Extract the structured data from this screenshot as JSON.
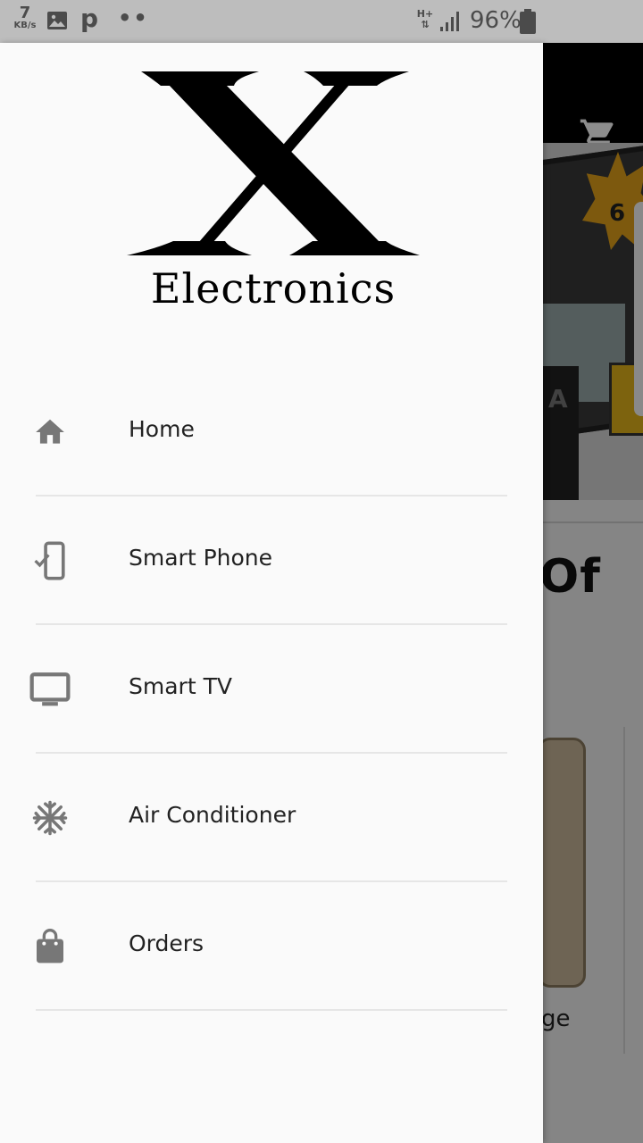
{
  "status_bar": {
    "speed_value": "7",
    "speed_unit": "KB/s",
    "app_letter": "p",
    "dots": "••",
    "network_type_top": "H+",
    "network_type_bottom": "⇅",
    "battery_percent": "96%"
  },
  "background": {
    "headline_fragment": "Of",
    "caption_fragment": "ge",
    "banner_badge": "6",
    "banner_letter": "A",
    "cart_icon": "shopping-cart-icon"
  },
  "drawer": {
    "logo": {
      "letter": "X",
      "wordmark": "Electronics"
    },
    "menu": [
      {
        "label": "Home",
        "icon": "home-icon"
      },
      {
        "label": "Smart Phone",
        "icon": "smartphone-check-icon"
      },
      {
        "label": "Smart TV",
        "icon": "tv-icon"
      },
      {
        "label": "Air Conditioner",
        "icon": "snowflake-icon"
      },
      {
        "label": "Orders",
        "icon": "shopping-bag-icon"
      }
    ]
  },
  "colors": {
    "icon_gray": "#777777",
    "drawer_bg": "#fafafa",
    "toolbar_bg": "#000000",
    "status_bar_bg": "#bdbdbd"
  }
}
